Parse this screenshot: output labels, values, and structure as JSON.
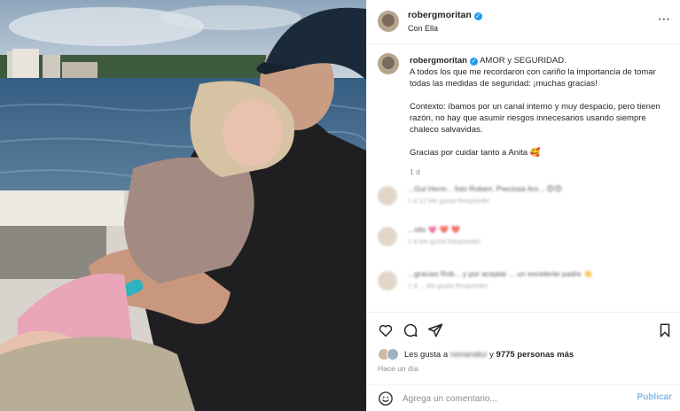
{
  "post": {
    "username": "robergmoritan",
    "subtitle": "Con Ella",
    "verified_color": "#1d9bf0"
  },
  "caption": {
    "username": "robergmoritan",
    "headline": "AMOR y SEGURIDAD.",
    "paragraph1": "A todos los que me recordaron con cariño la importancia de tomar todas las medidas de seguridad: ¡muchas gracias!",
    "paragraph2": "Contexto: íbamos por un canal interno y muy despacio, pero tienen razón, no hay que asumir riesgos innecesarios usando siempre chaleco salvavidas.",
    "paragraph3": "Gracias por cuidar tanto a Anita 🥰",
    "time": "1 d"
  },
  "comments": [
    {
      "text": "...Gui Herm... foto Robert. Preciosa Ani... 😍😍",
      "meta": "1 d   12 Me gusta   Responder"
    },
    {
      "text": "...sito 💗 ❤️ ❤️",
      "meta": "1 d   Me gusta   Responder"
    },
    {
      "text": "...gracias Rob... y por aceptar ... un excelente padre 👏",
      "meta": "1 d   ... Me gusta   Responder"
    }
  ],
  "likes": {
    "prefix": "Les gusta a",
    "name": "nonandez",
    "middle": "y",
    "count_text": "9775 personas más"
  },
  "posted": "Hace un día",
  "add_comment": {
    "placeholder": "Agrega un comentario...",
    "publish_label": "Publicar",
    "publish_color": "#7fb8e6"
  },
  "icons": {
    "more": "more-options-icon",
    "like": "heart-icon",
    "comment": "comment-bubble-icon",
    "share": "paper-plane-icon",
    "save": "bookmark-icon",
    "emoji": "smiley-icon"
  }
}
